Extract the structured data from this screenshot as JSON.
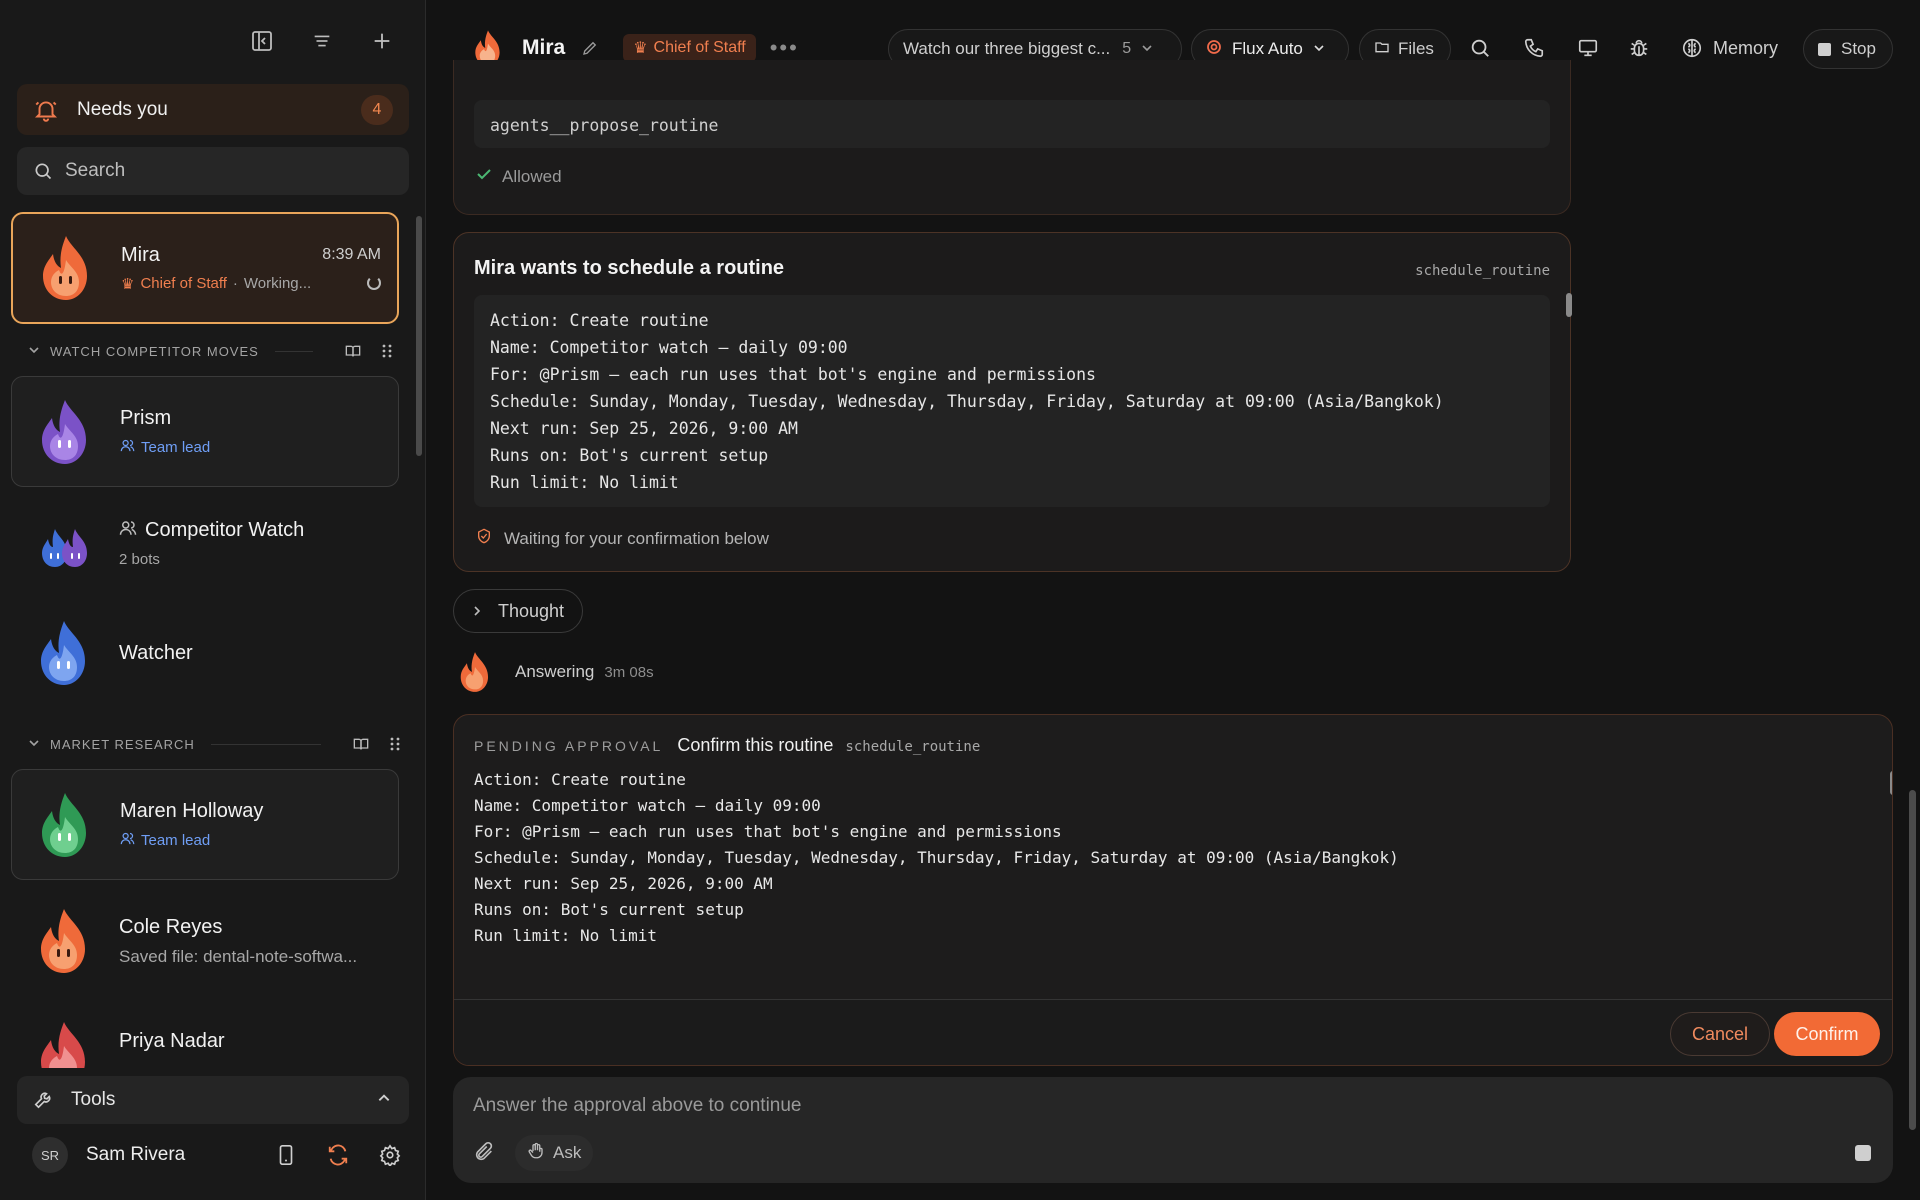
{
  "sidebar": {
    "needs_you": {
      "label": "Needs you",
      "count": "4"
    },
    "search_placeholder": "Search",
    "active_chat": {
      "name": "Mira",
      "time": "8:39 AM",
      "role": "Chief of Staff",
      "separator": "·",
      "status": "Working..."
    },
    "groups": [
      {
        "title": "WATCH COMPETITOR MOVES",
        "items": [
          {
            "name": "Prism",
            "sub": "Team lead"
          },
          {
            "name": "Competitor Watch",
            "sub": "2 bots"
          },
          {
            "name": "Watcher"
          }
        ]
      },
      {
        "title": "MARKET RESEARCH",
        "items": [
          {
            "name": "Maren Holloway",
            "sub": "Team lead"
          },
          {
            "name": "Cole Reyes",
            "sub": "Saved file: dental-note-softwa..."
          },
          {
            "name": "Priya Nadar"
          }
        ]
      }
    ],
    "tools_label": "Tools",
    "user": {
      "initials": "SR",
      "name": "Sam Rivera"
    }
  },
  "topbar": {
    "name": "Mira",
    "role": "Chief of Staff",
    "thread_title": "Watch our three biggest c...",
    "thread_count": "5",
    "model": "Flux Auto",
    "files": "Files",
    "memory": "Memory",
    "stop": "Stop"
  },
  "prev_block": {
    "code": "agents__propose_routine",
    "status": "Allowed"
  },
  "schedule_block": {
    "title": "Mira wants to schedule a routine",
    "tool": "schedule_routine",
    "lines": "Action: Create routine\nName: Competitor watch — daily 09:00\nFor: @Prism — each run uses that bot's engine and permissions\nSchedule: Sunday, Monday, Tuesday, Wednesday, Thursday, Friday, Saturday at 09:00 (Asia/Bangkok)\nNext run: Sep 25, 2026, 9:00 AM\nRuns on: Bot's current setup\nRun limit: No limit",
    "waiting": "Waiting for your confirmation below"
  },
  "thought_label": "Thought",
  "answering": {
    "label": "Answering",
    "elapsed": "3m 08s"
  },
  "approval": {
    "tag": "PENDING APPROVAL",
    "title": "Confirm this routine",
    "tool": "schedule_routine",
    "lines": "Action: Create routine\nName: Competitor watch — daily 09:00\nFor: @Prism — each run uses that bot's engine and permissions\nSchedule: Sunday, Monday, Tuesday, Wednesday, Thursday, Friday, Saturday at 09:00 (Asia/Bangkok)\nNext run: Sep 25, 2026, 9:00 AM\nRuns on: Bot's current setup\nRun limit: No limit",
    "cancel": "Cancel",
    "confirm": "Confirm"
  },
  "composer": {
    "placeholder": "Answer the approval above to continue",
    "ask": "Ask"
  },
  "colors": {
    "accent": "#f26a35",
    "team_lead": "#6f9ef5",
    "active_border": "#e9a55a"
  }
}
